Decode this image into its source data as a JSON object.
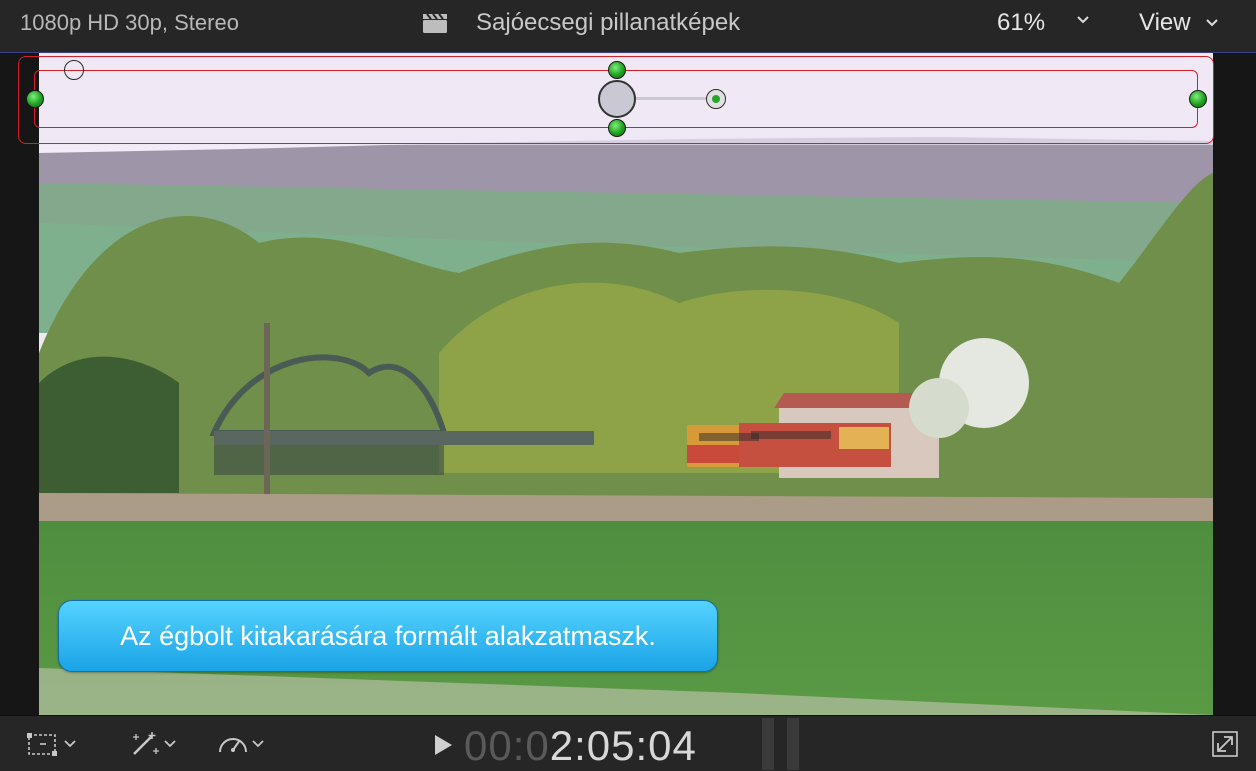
{
  "topbar": {
    "format": "1080p HD 30p, Stereo",
    "title": "Sajóecsegi pillanatképek",
    "zoom": "61%",
    "view_label": "View"
  },
  "viewer": {
    "callout_text": "Az égbolt kitakarására formált alakzatmaszk."
  },
  "timecode": {
    "dim_part": "00:0",
    "lit_part": "2:05:04"
  },
  "icons": {
    "clapper": "clapperboard-icon",
    "zoom_menu": "chevron-down-icon",
    "view_menu": "chevron-down-icon",
    "transform": "transform-icon",
    "enhance": "magic-wand-icon",
    "retime": "speedometer-icon",
    "play": "play-icon",
    "fullscreen": "fullscreen-icon"
  }
}
